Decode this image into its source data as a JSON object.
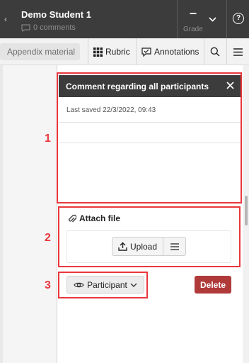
{
  "header": {
    "student_name": "Demo Student 1",
    "comments_count": "0 comments",
    "grade_value": "–",
    "grade_label": "Grade",
    "help_label": "?"
  },
  "toolbar": {
    "appendix_label": "Appendix material",
    "rubric_label": "Rubric",
    "annotations_label": "Annotations"
  },
  "comment_panel": {
    "title": "Comment regarding all participants",
    "last_saved": "Last saved 22/3/2022, 09:43"
  },
  "attach": {
    "title": "Attach file",
    "upload_label": "Upload"
  },
  "actions": {
    "participant_label": "Participant",
    "delete_label": "Delete"
  },
  "callouts": [
    "1",
    "2",
    "3"
  ],
  "icons": [
    "chat-bubble-icon",
    "chevron-down-icon",
    "help-icon",
    "grid-icon",
    "annotation-icon",
    "search-icon",
    "menu-icon",
    "close-icon",
    "paperclip-icon",
    "upload-icon",
    "eye-icon"
  ],
  "colors": {
    "header_bg": "#3c3c3c",
    "delete_bg": "#b03a3a",
    "highlight": "#e8383d"
  }
}
